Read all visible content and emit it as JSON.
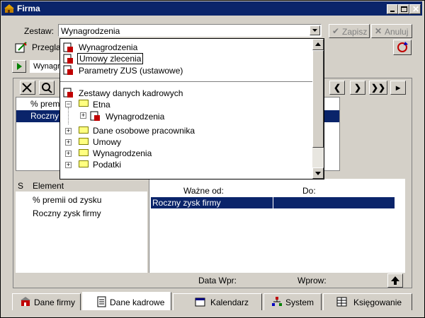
{
  "window": {
    "title": "Firma"
  },
  "toolbar": {
    "zestaw_label": "Zestaw:",
    "zestaw_value": "Wynagrodzenia",
    "zapisz_label": "Zapisz",
    "anuluj_label": "Anuluj",
    "przegla_label": "Przegla",
    "tab_label": "Wynagro"
  },
  "dropdown": {
    "items": [
      "Wynagrodzenia",
      "Umowy zlecenia",
      "Parametry ZUS (ustawowe)"
    ],
    "group_title": "Zestawy danych kadrowych",
    "tree": [
      "Etna",
      "Wynagrodzenia",
      "Dane osobowe pracownika",
      "Umowy",
      "Wynagrodzenia",
      "Podatki"
    ]
  },
  "upper_list": {
    "rows": [
      "% premii",
      "Roczny"
    ]
  },
  "lower_left": {
    "headers": {
      "s": "S",
      "element": "Element"
    },
    "rows": [
      "% premii od zysku",
      "Roczny zysk firmy"
    ]
  },
  "lower_right": {
    "headers": {
      "wazne_od": "Ważne od:",
      "do": "Do:"
    },
    "rows": [
      {
        "name": "Roczny zysk firmy",
        "date": ""
      }
    ]
  },
  "footer": {
    "data_wpr": "Data Wpr:",
    "wprow": "Wprow:"
  },
  "tabs": [
    "Dane firmy",
    "Dane kadrowe",
    "Kalendarz",
    "System",
    "Księgowanie"
  ],
  "active_tab": "Dane kadrowe",
  "colors": {
    "titlebar": "#0a246a",
    "selection": "#0a246a",
    "face": "#d4d0c8"
  }
}
